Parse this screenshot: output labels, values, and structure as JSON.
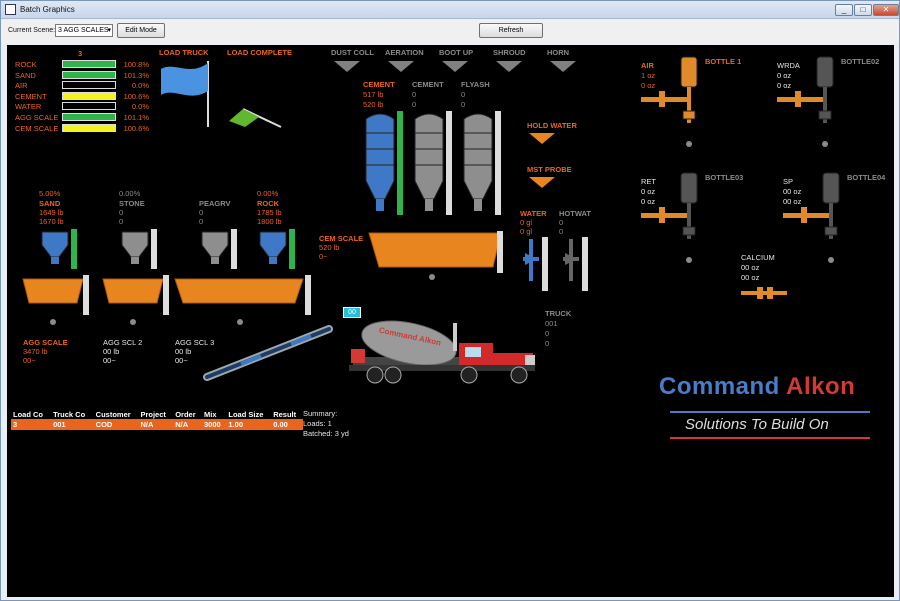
{
  "window": {
    "title": "Batch Graphics",
    "min": "_",
    "max": "□",
    "close": "✕"
  },
  "toolbar": {
    "scene_label": "Current Scene:",
    "scene_value": "3 AGG SCALES",
    "edit_mode": "Edit Mode",
    "refresh": "Refresh"
  },
  "materials": {
    "header": "3",
    "rows": [
      {
        "name": "ROCK",
        "pct": "100.8%",
        "fill": 1.0,
        "color": "#2fb34a"
      },
      {
        "name": "SAND",
        "pct": "101.3%",
        "fill": 1.0,
        "color": "#2fb34a"
      },
      {
        "name": "AIR",
        "pct": "0.0%",
        "fill": 0.0,
        "color": "#2fb34a"
      },
      {
        "name": "CEMENT",
        "pct": "100.6%",
        "fill": 1.0,
        "color": "#f4f11e"
      },
      {
        "name": "WATER",
        "pct": "0.0%",
        "fill": 0.0,
        "color": "#2fb34a"
      },
      {
        "name": "AGG SCALE",
        "pct": "101.1%",
        "fill": 1.0,
        "color": "#2fb34a"
      },
      {
        "name": "CEM SCALE",
        "pct": "100.6%",
        "fill": 1.0,
        "color": "#f4f11e"
      }
    ]
  },
  "status": {
    "load_truck": "LOAD TRUCK",
    "load_complete": "LOAD COMPLETE"
  },
  "indicators": [
    "DUST COLL",
    "AERATION",
    "BOOT UP",
    "SHROUD",
    "HORN"
  ],
  "cement_silos": [
    {
      "name": "CEMENT",
      "v1": "517 lb",
      "v2": "520 lb",
      "color": "#3e78c6",
      "level": 1.0,
      "active": true
    },
    {
      "name": "CEMENT",
      "v1": "0",
      "v2": "0",
      "color": "#8e8e8e",
      "level": 0.0,
      "active": false
    },
    {
      "name": "FLYASH",
      "v1": "0",
      "v2": "0",
      "color": "#8e8e8e",
      "level": 0.0,
      "active": false
    }
  ],
  "hold_water": "HOLD WATER",
  "mst_probe": "MST PROBE",
  "aggregate_bins": [
    {
      "pct": "5.00%",
      "name": "SAND",
      "v1": "1649 lb",
      "v2": "1670 lb",
      "color": "#3e78c6",
      "active": true
    },
    {
      "pct": "0.00%",
      "name": "STONE",
      "v1": "0",
      "v2": "0",
      "color": "#8e8e8e",
      "active": false
    },
    {
      "pct": "",
      "name": "PEAGRV",
      "v1": "0",
      "v2": "0",
      "color": "#8e8e8e",
      "active": false
    },
    {
      "pct": "0.00%",
      "name": "ROCK",
      "v1": "1785 lb",
      "v2": "1800 lb",
      "color": "#3e78c6",
      "active": true
    }
  ],
  "cem_scale": {
    "name": "CEM SCALE",
    "v1": "520 lb",
    "v2": "0~"
  },
  "water": {
    "name": "WATER",
    "v1": "0 gl",
    "v2": "0 gl"
  },
  "hotwat": {
    "name": "HOTWAT",
    "v1": "0",
    "v2": "0"
  },
  "agg_scales": [
    {
      "name": "AGG SCALE",
      "v1": "3470 lb",
      "v2": "00~",
      "active": true
    },
    {
      "name": "AGG SCL 2",
      "v1": "00 lb",
      "v2": "00~",
      "active": false
    },
    {
      "name": "AGG SCL 3",
      "v1": "00 lb",
      "v2": "00~",
      "active": false
    }
  ],
  "truck": {
    "name": "TRUCK",
    "l1": "001",
    "l2": "0",
    "l3": "0",
    "drum_text": "Command Alkon",
    "badge": "00"
  },
  "bottles": [
    {
      "label": "AIR",
      "bottle": "BOTTLE 1",
      "v1": "1 oz",
      "v2": "0 oz",
      "color": "#e08a2a",
      "active": true
    },
    {
      "label": "WRDA",
      "bottle": "BOTTLE02",
      "v1": "0 oz",
      "v2": "0 oz",
      "color": "#555555",
      "active": false
    },
    {
      "label": "RET",
      "bottle": "BOTTLE03",
      "v1": "0 oz",
      "v2": "0 oz",
      "color": "#555555",
      "active": false
    },
    {
      "label": "SP",
      "bottle": "BOTTLE04",
      "v1": "00 oz",
      "v2": "00 oz",
      "color": "#555555",
      "active": false
    }
  ],
  "calcium": {
    "label": "CALCIUM",
    "v1": "00 oz",
    "v2": "00 oz"
  },
  "tickets": {
    "headers": [
      "Load Co",
      "Truck Co",
      "Customer",
      "Project",
      "Order",
      "Mix",
      "Load Size",
      "Result"
    ],
    "row": [
      "3",
      "001",
      "COD",
      "N/A",
      "N/A",
      "3000",
      "1.00",
      "0.00"
    ]
  },
  "summary": {
    "title": "Summary:",
    "loads": "Loads: 1",
    "batched": "Batched: 3 yd"
  },
  "brand": {
    "name1": "Command",
    "name2": "Alkon",
    "tagline": "Solutions To Build On"
  }
}
